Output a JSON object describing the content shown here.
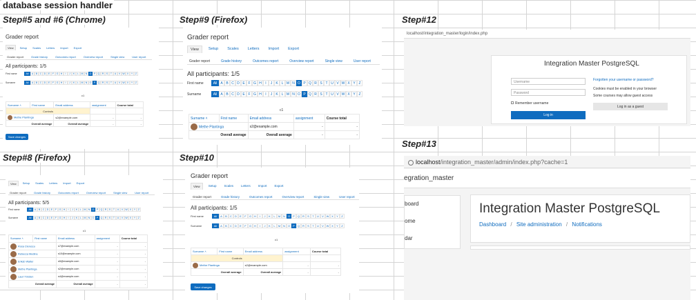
{
  "heading": "database session handler",
  "steps": {
    "s56": "Step#5 and #6 (Chrome)",
    "s9": "Step#9 (Firefox)",
    "s12": "Step#12",
    "s8": "Step#8 (Firefox)",
    "s10": "Step#10",
    "s13": "Step#13"
  },
  "grader": {
    "title": "Grader report",
    "tabs": [
      "View",
      "Setup",
      "Scales",
      "Letters",
      "Import",
      "Export"
    ],
    "subtabs": [
      "Grader report",
      "Grade history",
      "Outcomes report",
      "Overview report",
      "Single view",
      "User report"
    ],
    "participants_1": "All participants: 1/5",
    "participants_5": "All participants: 5/5",
    "first_name_label": "First name",
    "surname_label": "Surname",
    "all_label": "All",
    "letters": [
      "A",
      "B",
      "C",
      "D",
      "E",
      "F",
      "G",
      "H",
      "I",
      "J",
      "K",
      "L",
      "M",
      "N",
      "O",
      "P",
      "Q",
      "R",
      "S",
      "T",
      "U",
      "V",
      "W",
      "X",
      "Y",
      "Z"
    ],
    "selected_letter_first": "O",
    "selected_letter_surname": "P",
    "course_code": "c1",
    "col_surname": "Surname ˄",
    "col_firstname": "First name",
    "col_email": "Email address",
    "col_assignment": "assignment",
    "col_course_total": "Course total",
    "controls": "Controls",
    "overall_average": "Overall average",
    "save_changes": "Save changes",
    "single_student": {
      "name": "Methe Plantinga",
      "email": "s2@example.com"
    },
    "students": [
      {
        "name": "Rosa Clerescu",
        "email": "s7@example.com"
      },
      {
        "name": "Rebecca Medina",
        "email": "s10@example.com"
      },
      {
        "name": "Eriksb Walter",
        "email": "s5@example.com"
      },
      {
        "name": "Methe Plantinga",
        "email": "s2@example.com"
      },
      {
        "name": "Lauri Törsten",
        "email": "s4@example.com"
      }
    ],
    "dash": "-"
  },
  "login": {
    "url": "localhost/integration_master/login/index.php",
    "title": "Integration Master PostgreSQL",
    "username_placeholder": "Username",
    "password_placeholder": "Password",
    "remember": "Remember username",
    "login_btn": "Log in",
    "forgot": "Forgotten your username or password?",
    "cookies": "Cookies must be enabled in your browser",
    "guest_note": "Some courses may allow guest access",
    "guest_btn": "Log in as a guest"
  },
  "admin": {
    "url_host": "localhost",
    "url_path": "/integration_master/admin/index.php?cache=1",
    "site_short": "egration_master",
    "site_title": "Integration Master PostgreSQL",
    "breadcrumb": [
      "Dashboard",
      "Site administration",
      "Notifications"
    ],
    "nav": [
      "board",
      "ome",
      "dar"
    ]
  },
  "colors": {
    "accent": "#0f6cbf",
    "grid": "#d4d4d4"
  }
}
